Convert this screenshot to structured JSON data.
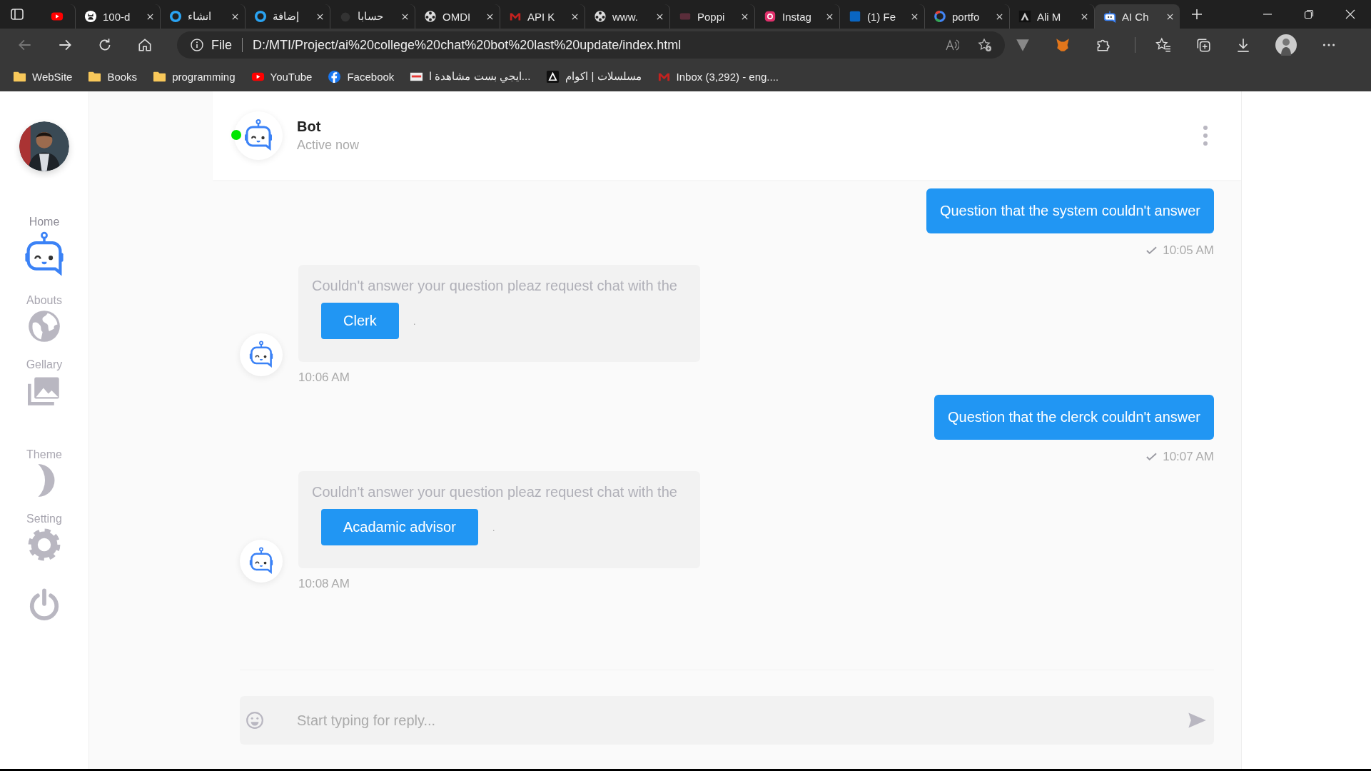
{
  "browser": {
    "tabs": [
      {
        "selected": false
      },
      {
        "title": "100-d",
        "selected": false
      },
      {
        "title": "انشاء",
        "selected": false
      },
      {
        "title": "إضافة",
        "selected": false
      },
      {
        "title": "حسابا",
        "selected": false
      },
      {
        "title": "OMDI",
        "selected": false
      },
      {
        "title": "API K",
        "selected": false
      },
      {
        "title": "www.",
        "selected": false
      },
      {
        "title": "Poppi",
        "selected": false
      },
      {
        "title": "Instag",
        "selected": false
      },
      {
        "title": "(1) Fe",
        "selected": false
      },
      {
        "title": "portfo",
        "selected": false
      },
      {
        "title": "Ali M",
        "selected": false
      },
      {
        "title": "AI Ch",
        "selected": true
      }
    ],
    "address": {
      "scheme": "File",
      "url": "D:/MTI/Project/ai%20college%20chat%20bot%20last%20update/index.html"
    },
    "bookmarks": [
      {
        "label": "WebSite"
      },
      {
        "label": "Books"
      },
      {
        "label": "programming"
      },
      {
        "label": "YouTube"
      },
      {
        "label": "Facebook"
      },
      {
        "label": "ايجي بست مشاهدة ا..."
      },
      {
        "label": "مسلسلات | اكوام"
      },
      {
        "label": "Inbox (3,292) - eng...."
      }
    ]
  },
  "sidebar": {
    "items": [
      {
        "label": "Home",
        "selected": true
      },
      {
        "label": "Abouts",
        "selected": false
      },
      {
        "label": "Gellary",
        "selected": false
      },
      {
        "label": "Theme",
        "selected": false
      },
      {
        "label": "Setting",
        "selected": false
      }
    ]
  },
  "chat": {
    "header": {
      "name": "Bot",
      "status": "Active now",
      "online": true
    },
    "messages": [
      {
        "kind": "user",
        "text": "Question that the system couldn't answer",
        "time": "10:05 AM",
        "delivered": true
      },
      {
        "kind": "bot",
        "text": "Couldn't answer your question pleaz request chat with the",
        "action": "Clerk",
        "trailing": ".",
        "time": "10:06 AM"
      },
      {
        "kind": "user",
        "text": "Question that the clerck couldn't answer",
        "time": "10:07 AM",
        "delivered": true
      },
      {
        "kind": "bot",
        "text": "Couldn't answer your question pleaz request chat with the",
        "action": "Acadamic advisor",
        "trailing": ".",
        "time": "10:08 AM"
      }
    ],
    "input": {
      "placeholder": "Start typing for reply..."
    }
  }
}
